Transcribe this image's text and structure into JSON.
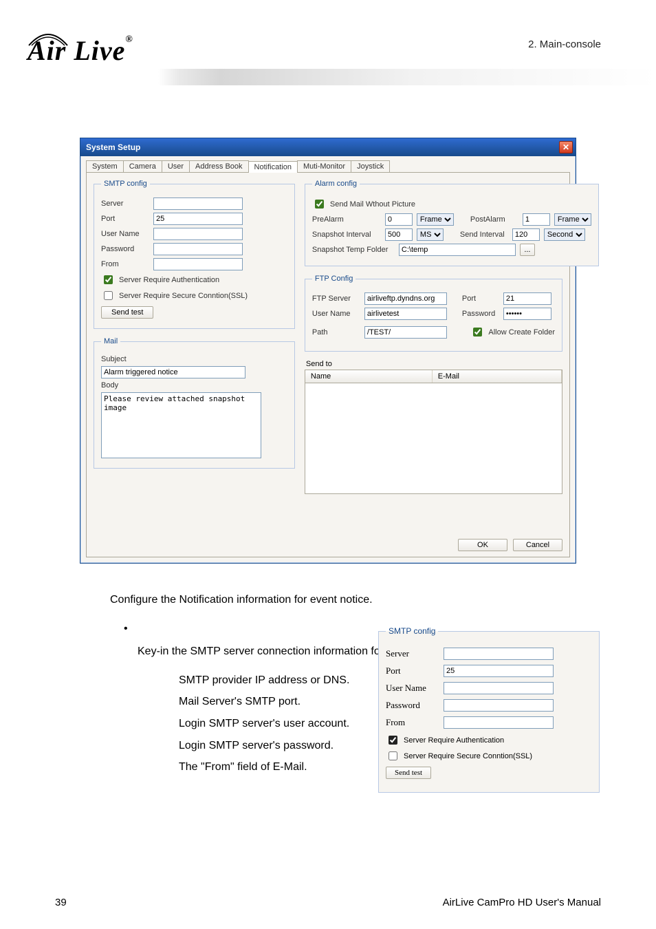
{
  "header": {
    "section": "2.  Main-console",
    "logo": "Air Live"
  },
  "dialog": {
    "title": "System Setup",
    "tabs": [
      "System",
      "Camera",
      "User",
      "Address Book",
      "Notification",
      "Muti-Monitor",
      "Joystick"
    ],
    "active_tab_index": 4,
    "smtp": {
      "legend": "SMTP config",
      "server_label": "Server",
      "server": "",
      "port_label": "Port",
      "port": "25",
      "user_label": "User Name",
      "user": "",
      "pass_label": "Password",
      "pass": "",
      "from_label": "From",
      "from": "",
      "chk_auth": "Server Require Authentication",
      "chk_ssl": "Server Require Secure Conntion(SSL)",
      "btn_sendtest": "Send test"
    },
    "alarm": {
      "legend": "Alarm config",
      "chk_nopic": "Send Mail Wthout Picture",
      "prealarm_label": "PreAlarm",
      "prealarm_val": "0",
      "prealarm_unit": "Frame",
      "postalarm_label": "PostAlarm",
      "postalarm_val": "1",
      "postalarm_unit": "Frame",
      "snap_int_label": "Snapshot Interval",
      "snap_int_val": "500",
      "snap_int_unit": "MS",
      "send_int_label": "Send Interval",
      "send_int_val": "120",
      "send_int_unit": "Second",
      "snap_folder_label": "Snapshot Temp Folder",
      "snap_folder_val": "C:\\temp",
      "browse": "..."
    },
    "ftp": {
      "legend": "FTP Config",
      "server_label": "FTP Server",
      "server": "airliveftp.dyndns.org",
      "port_label": "Port",
      "port": "21",
      "user_label": "User Name",
      "user": "airlivetest",
      "pass_label": "Password",
      "pass": "••••••",
      "path_label": "Path",
      "path": "/TEST/",
      "chk_create": "Allow Create Folder"
    },
    "mail": {
      "legend": "Mail",
      "subject_label": "Subject",
      "subject": "Alarm triggered notice",
      "body_label": "Body",
      "body": "Please review attached snapshot image"
    },
    "sendto": {
      "label": "Send to",
      "col_name": "Name",
      "col_email": "E-Mail"
    },
    "buttons": {
      "ok": "OK",
      "cancel": "Cancel"
    }
  },
  "bodytext": {
    "intro": "Configure the Notification information for event notice.",
    "smtp_heading_line": "Key-in the SMTP server connection information for sending event notice mail.",
    "items": [
      "SMTP provider IP address or DNS.",
      "Mail Server's SMTP port.",
      "Login SMTP server's user account.",
      "Login SMTP server's password.",
      "The \"From\" field of E-Mail."
    ]
  },
  "dialog2": {
    "legend": "SMTP config",
    "server_label": "Server",
    "server": "",
    "port_label": "Port",
    "port": "25",
    "user_label": "User Name",
    "user": "",
    "pass_label": "Password",
    "pass": "",
    "from_label": "From",
    "from": "",
    "chk_auth": "Server Require Authentication",
    "chk_ssl": "Server Require Secure Conntion(SSL)",
    "btn_sendtest": "Send test"
  },
  "footer": {
    "manual": "AirLive CamPro HD User's Manual",
    "page": "39"
  }
}
